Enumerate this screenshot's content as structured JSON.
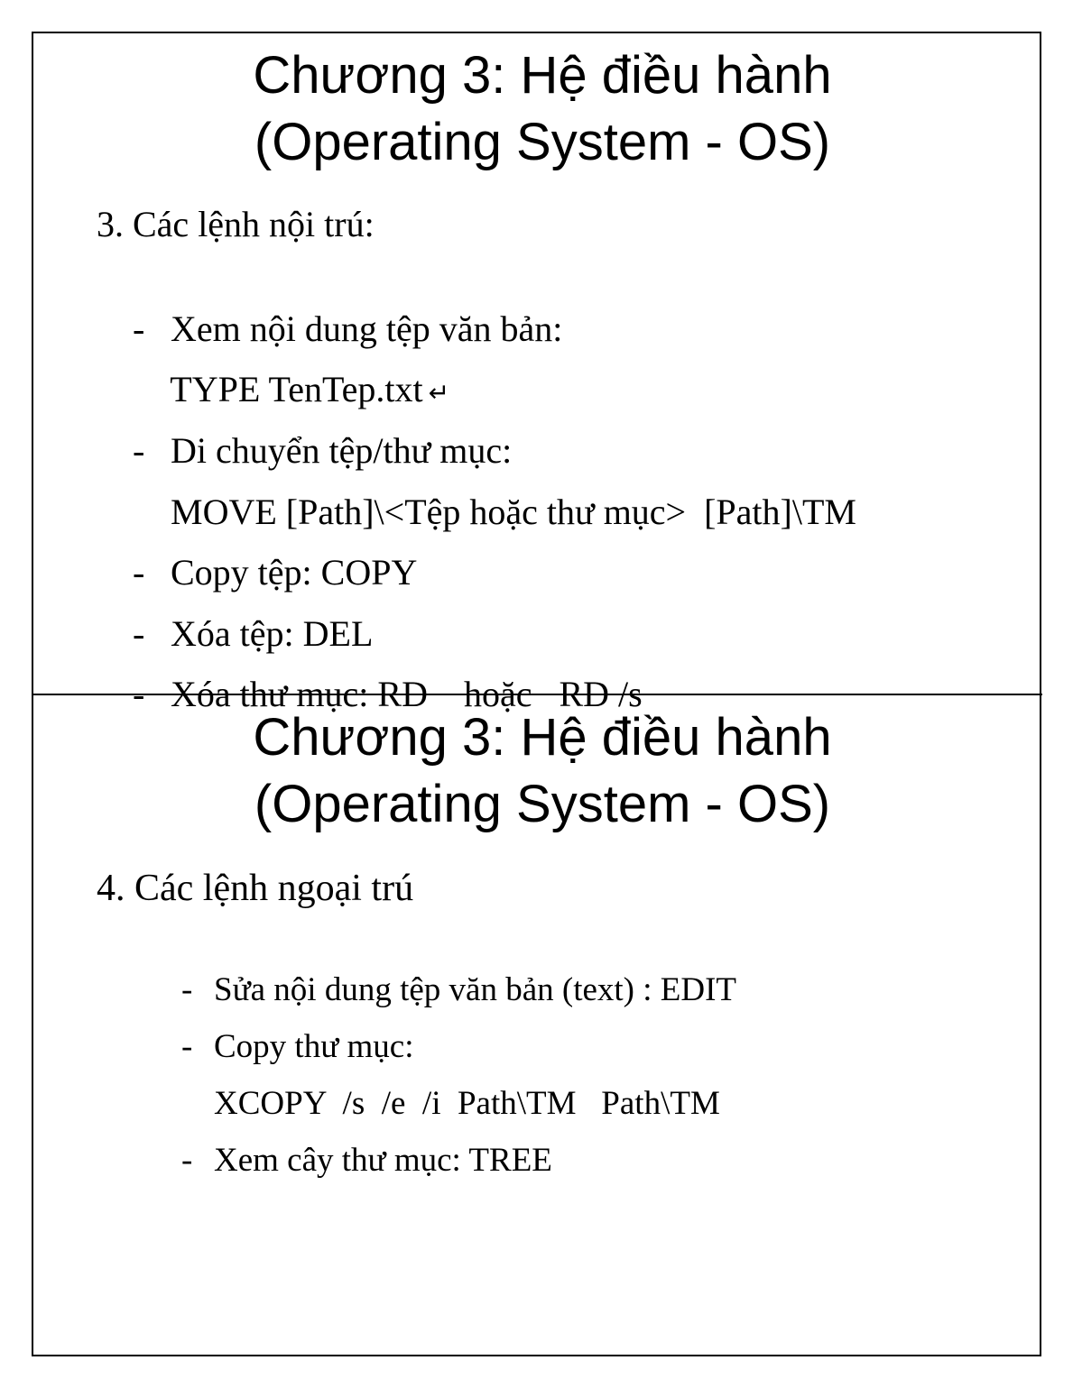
{
  "slides": [
    {
      "title_line1": "Chương 3: Hệ điều hành",
      "title_line2": "(Operating System - OS)",
      "heading": "3. Các lệnh nội trú:",
      "items": [
        {
          "bullet": "-",
          "text": "Xem nội dung tệp văn bản:"
        },
        {
          "bullet": "",
          "text": "TYPE TenTep.txt",
          "icon": "↵"
        },
        {
          "bullet": "-",
          "text": "Di chuyển tệp/thư mục:"
        },
        {
          "bullet": "",
          "text": "MOVE [Path]\\<Tệp hoặc thư mục>  [Path]\\TM"
        },
        {
          "bullet": "-",
          "text": "Copy tệp: COPY"
        },
        {
          "bullet": "-",
          "text": "Xóa tệp: DEL"
        },
        {
          "bullet": "-",
          "text": "Xóa thư mục: RD    hoặc   RD /s"
        }
      ]
    },
    {
      "title_line1": "Chương 3: Hệ điều hành",
      "title_line2": "(Operating System - OS)",
      "heading": "4. Các lệnh ngoại trú",
      "items": [
        {
          "bullet": "-",
          "text": "Sửa nội dung tệp văn bản (text) : EDIT"
        },
        {
          "bullet": "-",
          "text": "Copy thư mục:"
        },
        {
          "bullet": "",
          "text": "XCOPY  /s  /e  /i  Path\\TM   Path\\TM"
        },
        {
          "bullet": "-",
          "text": "Xem cây thư mục: TREE"
        }
      ]
    }
  ]
}
